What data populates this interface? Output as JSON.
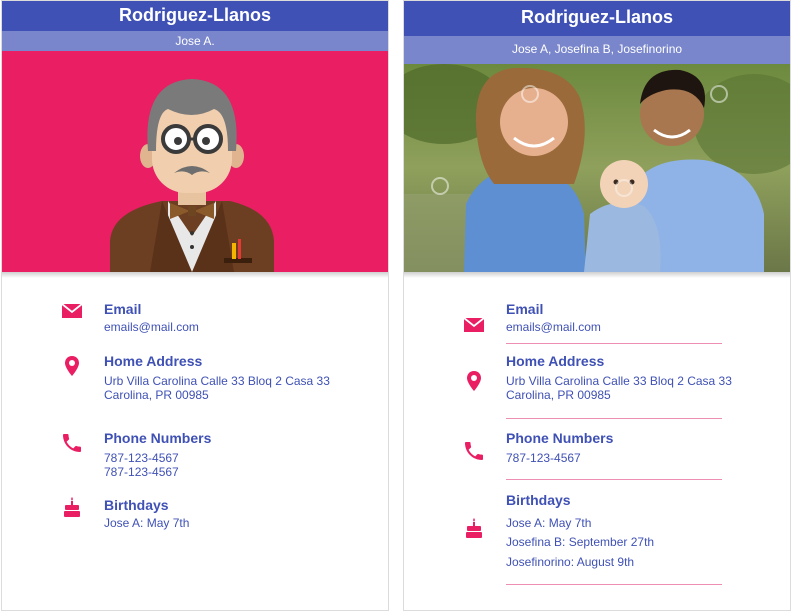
{
  "colors": {
    "primary": "#3f51b5",
    "primary_light": "#7986cb",
    "accent": "#e91e63",
    "text": "#3f51b5"
  },
  "left_card": {
    "title": "Rodriguez-Llanos",
    "subtitle": "Jose A.",
    "avatar": "illustrated-grandfather-avatar",
    "email": {
      "icon": "envelope-icon",
      "label": "Email",
      "value": "emails@mail.com"
    },
    "address": {
      "icon": "location-pin-icon",
      "label": "Home Address",
      "line1": "Urb Villa Carolina Calle 33 Bloq 2 Casa 33",
      "line2": "Carolina, PR 00985"
    },
    "phones": {
      "icon": "phone-icon",
      "label": "Phone Numbers",
      "items": [
        "787-123-4567",
        "787-123-4567"
      ]
    },
    "birthdays": {
      "icon": "cake-icon",
      "label": "Birthdays",
      "items": [
        "Jose A: May 7th"
      ]
    }
  },
  "right_card": {
    "title": "Rodriguez-Llanos",
    "subtitle": "Jose A,  Josefina B, Josefinorino",
    "photo": "family-photo",
    "email": {
      "icon": "envelope-icon",
      "label": "Email",
      "value": "emails@mail.com"
    },
    "address": {
      "icon": "location-pin-icon",
      "label": "Home Address",
      "line1": "Urb Villa Carolina Calle 33 Bloq 2 Casa 33",
      "line2": "Carolina, PR 00985"
    },
    "phones": {
      "icon": "phone-icon",
      "label": "Phone Numbers",
      "items": [
        "787-123-4567"
      ]
    },
    "birthdays": {
      "icon": "cake-icon",
      "label": "Birthdays",
      "items": [
        "Jose A: May 7th",
        "Josefina B: September 27th",
        "Josefinorino: August 9th"
      ]
    }
  }
}
